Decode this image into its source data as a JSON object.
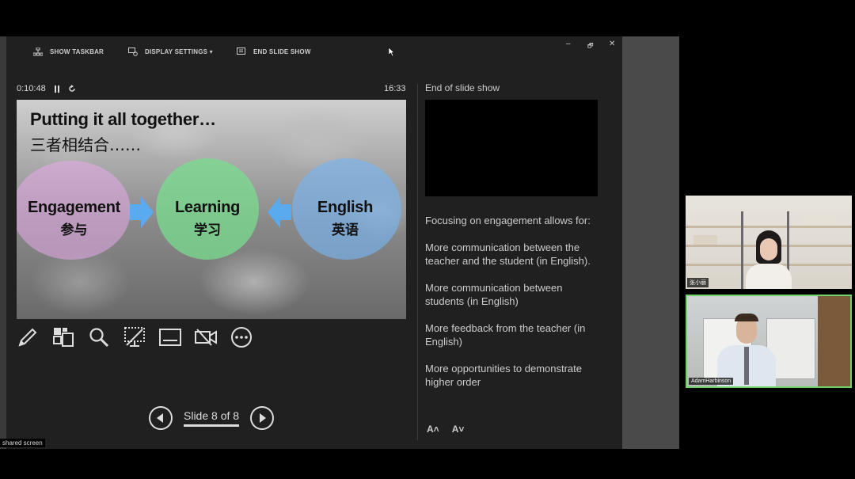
{
  "toolbar": {
    "show_taskbar": "SHOW TASKBAR",
    "display_settings": "DISPLAY SETTINGS ▾",
    "end_slide_show": "END SLIDE SHOW"
  },
  "window_controls": {
    "minimize": "–",
    "restore": "🗗",
    "close": "✕"
  },
  "presenter": {
    "elapsed": "0:10:48",
    "clock": "16:33",
    "slide_counter": "Slide 8 of 8"
  },
  "slide": {
    "title": "Putting it all together…",
    "subtitle": "三者相结合……",
    "circles": [
      {
        "en": "Engagement",
        "zh": "参与",
        "color": "#e6aaeb"
      },
      {
        "en": "Learning",
        "zh": "学习",
        "color": "#78dc8c"
      },
      {
        "en": "English",
        "zh": "英语",
        "color": "#78b4f0"
      }
    ],
    "arrow_color": "#5aaaf0"
  },
  "next_slide": {
    "label": "End of slide show"
  },
  "notes": [
    "Focusing on engagement allows for:",
    "More communication between the teacher and the student (in English).",
    "More communication between students (in English)",
    "More feedback from the teacher (in English)",
    "More opportunities to demonstrate higher order"
  ],
  "font_controls": {
    "increase": "A˄",
    "decrease": "A˅"
  },
  "meeting": {
    "shared_label": "shared screen",
    "participants": [
      {
        "name": "张小丽",
        "active_speaker": false
      },
      {
        "name": "AdamHarbinson",
        "active_speaker": true
      }
    ],
    "active_speaker_color": "#6fd36a"
  }
}
